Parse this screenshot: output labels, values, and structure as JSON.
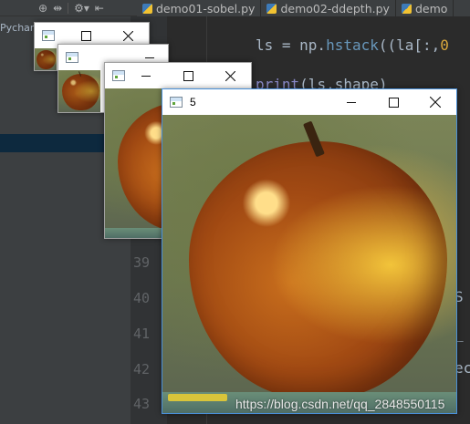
{
  "ide": {
    "toolbar_icons": [
      "target-icon",
      "split-icon",
      "gear-icon",
      "collapse-icon"
    ],
    "tabs": [
      {
        "label": "demo01-sobel.py",
        "icon": "python-file-icon"
      },
      {
        "label": "demo02-ddepth.py",
        "icon": "python-file-icon"
      },
      {
        "label": "demo",
        "icon": "python-file-icon"
      }
    ],
    "project_label": "Pycharm",
    "code_lines": [
      {
        "num": "",
        "text": "ls = np.hstack((la[:,0"
      },
      {
        "num": "",
        "text": "print(ls.shape)"
      }
    ],
    "line_numbers": [
      "39",
      "40",
      "41",
      "42",
      "43"
    ],
    "right_chars": [
      "S",
      "_",
      "x",
      "ec"
    ]
  },
  "windows": [
    {
      "title": "",
      "id": "window-1"
    },
    {
      "title": "",
      "id": "window-2"
    },
    {
      "title": "",
      "id": "window-3"
    },
    {
      "title": "5",
      "id": "window-4"
    }
  ],
  "watermark": "https://blog.csdn.net/qq_2848550115"
}
